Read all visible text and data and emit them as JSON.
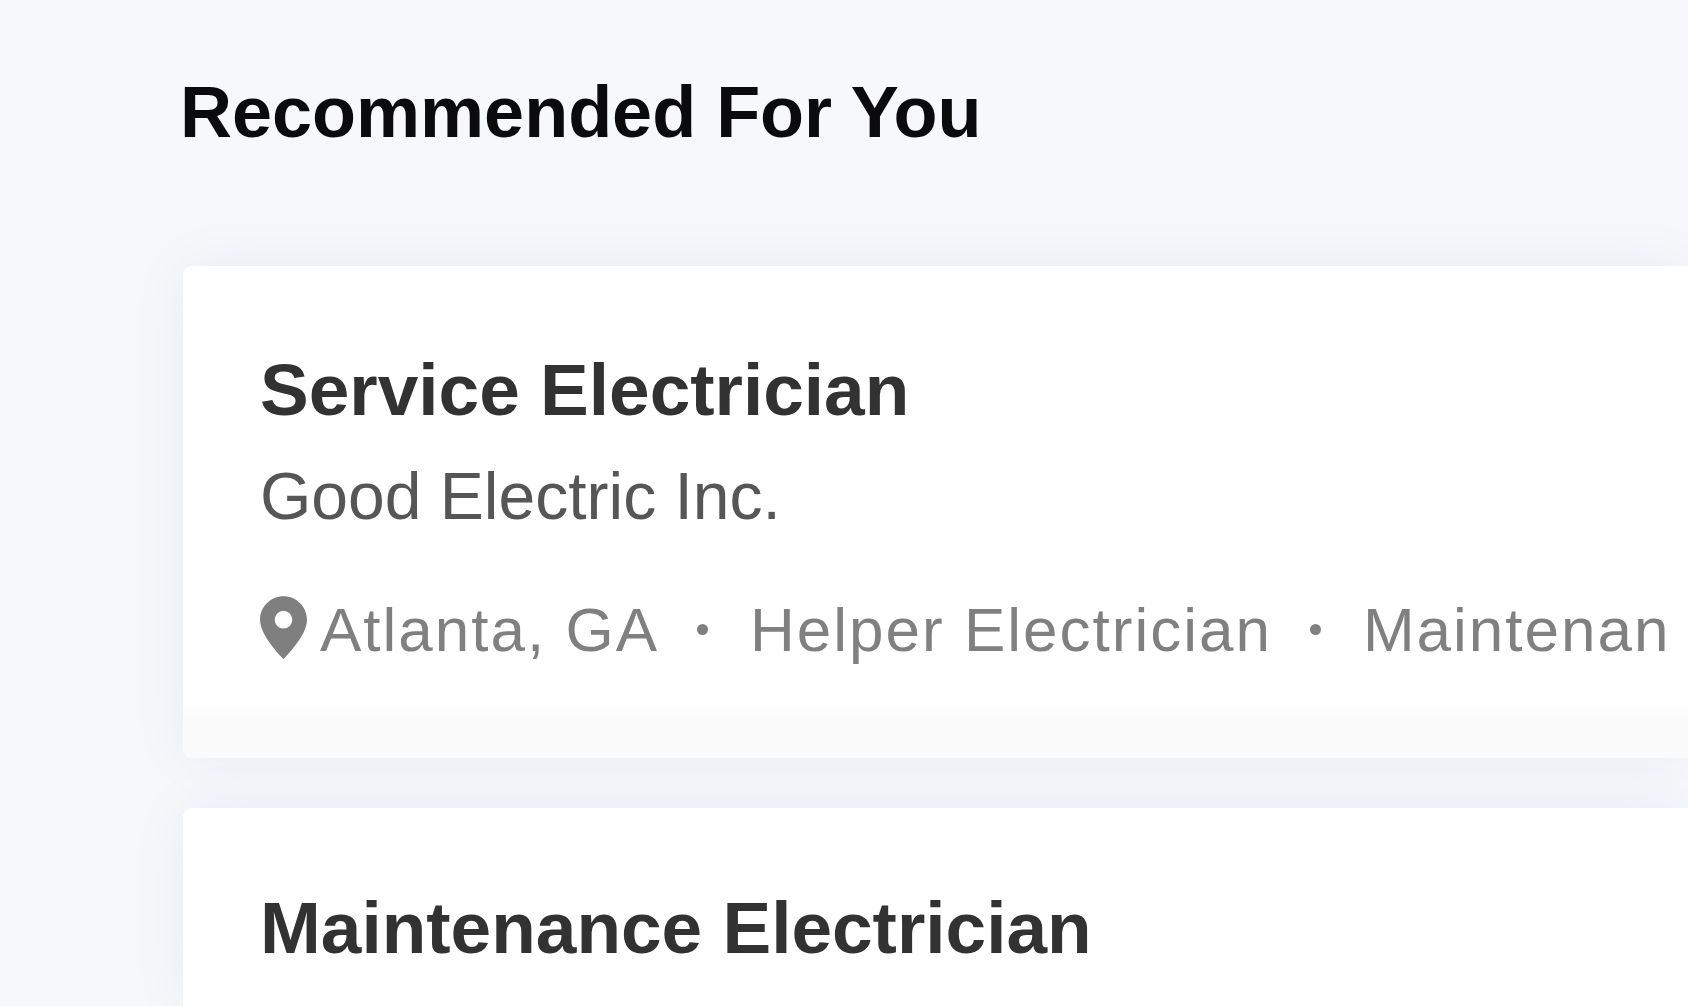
{
  "page": {
    "heading": "Recommended For You"
  },
  "jobs": [
    {
      "title": "Service Electrician",
      "company": "Good Electric Inc.",
      "location": "Atlanta, GA",
      "tags": [
        "Helper Electrician",
        "Maintenan"
      ]
    },
    {
      "title": "Maintenance Electrician"
    }
  ]
}
